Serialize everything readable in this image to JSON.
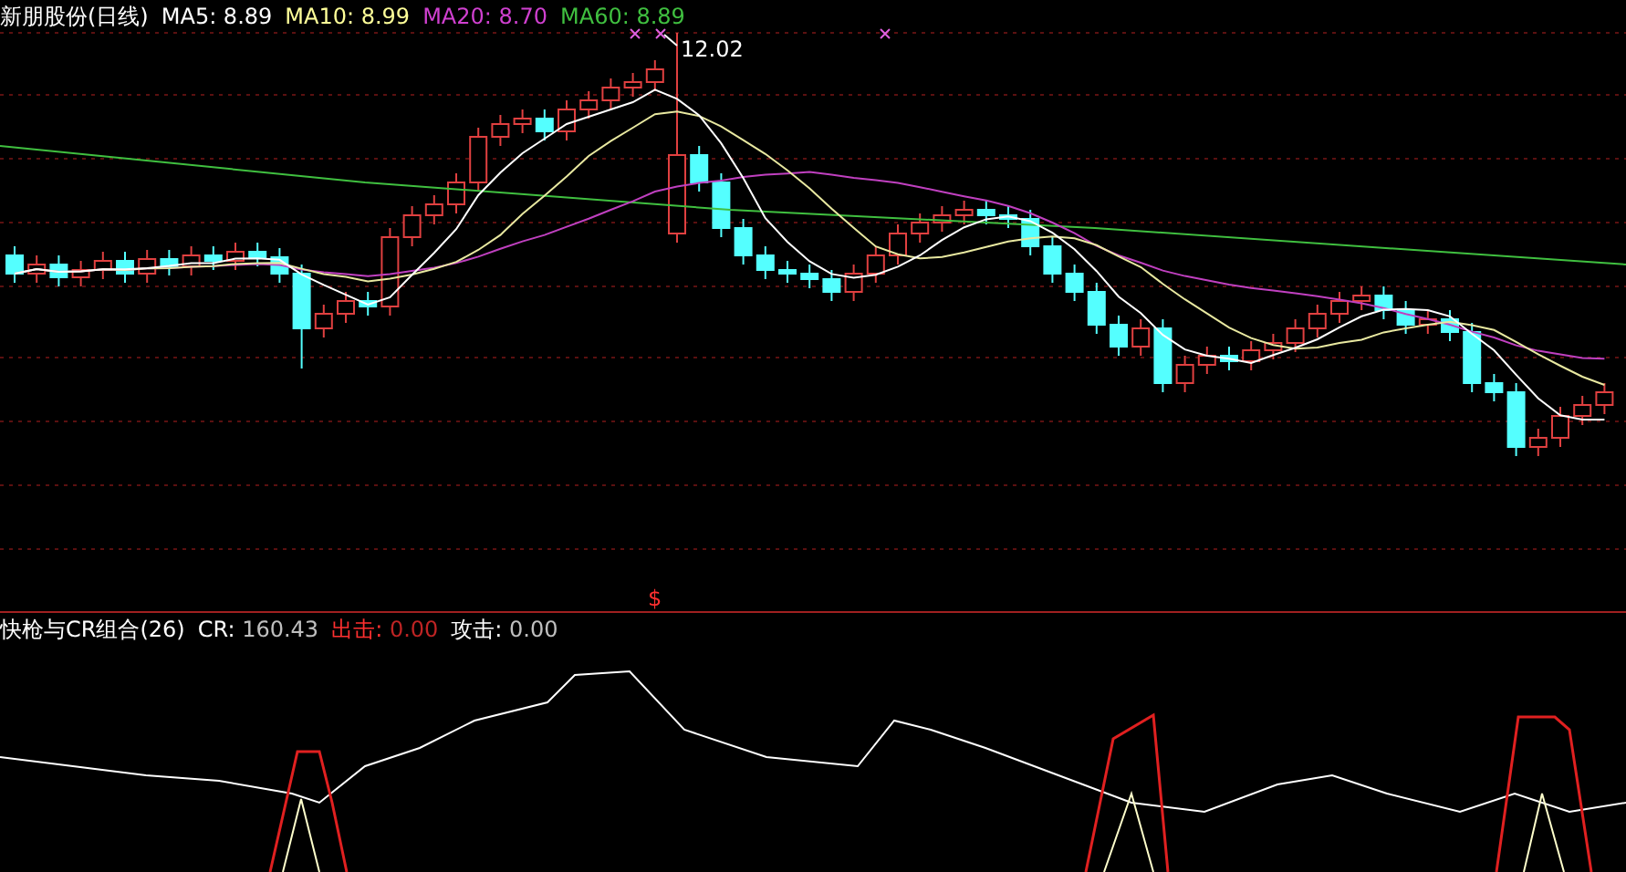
{
  "price_panel": {
    "title": "新朋股份(日线)",
    "legend": [
      {
        "text": "MA5: 8.89",
        "color": "#ffffff"
      },
      {
        "text": "MA10: 8.99",
        "color": "#ffff99"
      },
      {
        "text": "MA20: 8.70",
        "color": "#d040d0"
      },
      {
        "text": "MA60: 8.89",
        "color": "#40c040"
      }
    ],
    "high_label": "12.02",
    "signal_mark": "$"
  },
  "indicator_panel": {
    "title": "快枪与CR组合(26)",
    "legend": [
      {
        "label": "CR:",
        "value": "160.43",
        "color": "#ffffff"
      },
      {
        "label": "出击:",
        "value": "0.00",
        "color": "#ff3030"
      },
      {
        "label": "攻击:",
        "value": "0.00",
        "color": "#ffffff"
      }
    ]
  }
}
